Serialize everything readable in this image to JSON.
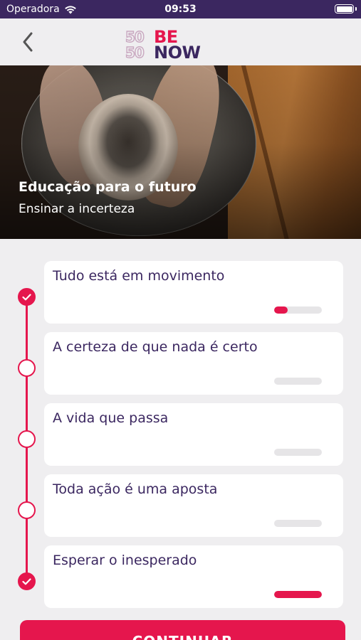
{
  "status_bar": {
    "carrier": "Operadora",
    "time": "09:53"
  },
  "header": {
    "logo": {
      "line1_number": "50",
      "line1_word": "BE",
      "line2_number": "50",
      "line2_word": "NOW"
    },
    "back_icon": "chevron-left-icon"
  },
  "hero": {
    "title": "Educação para o futuro",
    "subtitle": "Ensinar a incerteza"
  },
  "lessons": [
    {
      "label": "Tudo está em movimento",
      "completed": true,
      "progress": 0.28
    },
    {
      "label": "A certeza de que nada é certo",
      "completed": false,
      "progress": 0
    },
    {
      "label": "A vida que passa",
      "completed": false,
      "progress": 0
    },
    {
      "label": "Toda ação é uma aposta",
      "completed": false,
      "progress": 0
    },
    {
      "label": "Esperar o inesperado",
      "completed": true,
      "progress": 1.0
    }
  ],
  "cta": {
    "label": "CONTINUAR"
  },
  "colors": {
    "brand_primary": "#e5164d",
    "brand_dark": "#3b2760",
    "background": "#efeef0",
    "track": "#e6e5e7"
  }
}
